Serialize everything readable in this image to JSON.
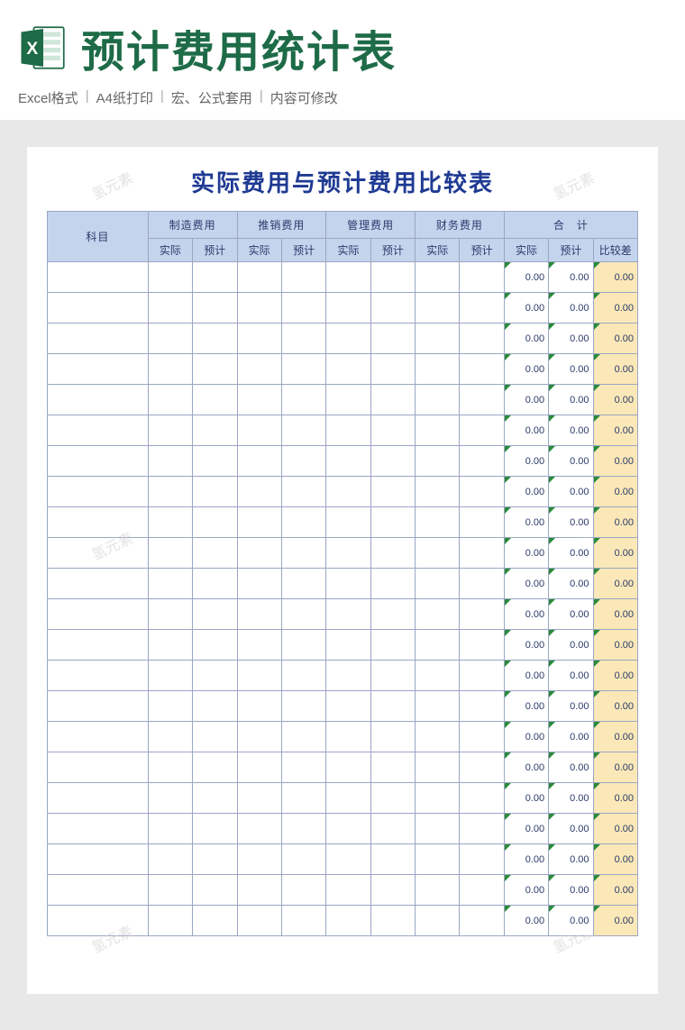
{
  "header": {
    "title": "预计费用统计表",
    "meta": [
      "Excel格式",
      "A4纸打印",
      "宏、公式套用",
      "内容可修改"
    ]
  },
  "sheet": {
    "title": "实际费用与预计费用比较表",
    "col_subject": "科目",
    "groups": [
      "制造费用",
      "推销费用",
      "管理费用",
      "财务费用"
    ],
    "sum_group": "合　计",
    "sub_actual": "实际",
    "sub_budget": "预计",
    "sub_diff": "比较差",
    "zero": "0.00",
    "row_count": 22
  },
  "colors": {
    "brand_green": "#1e6b47",
    "header_blue": "#c4d4ed",
    "text_navy": "#2b3a6b",
    "calc_yellow": "#fbe8b8"
  },
  "watermark": "氢元素"
}
